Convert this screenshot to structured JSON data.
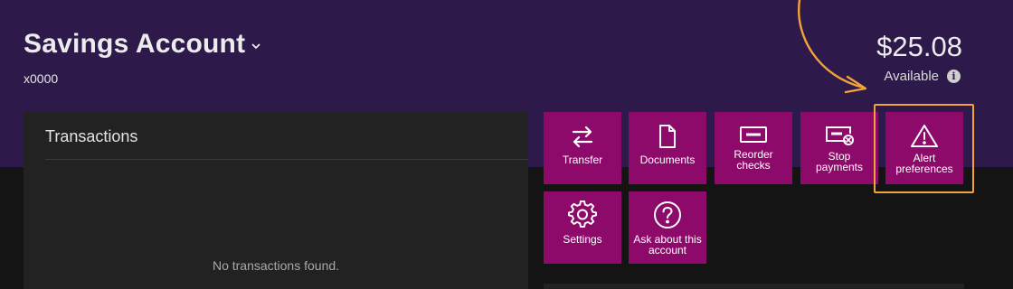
{
  "account": {
    "title": "Savings Account",
    "number": "x0000",
    "balance": "$25.08",
    "available_label": "Available"
  },
  "transactions": {
    "title": "Transactions",
    "empty_message": "No transactions found."
  },
  "actions": [
    {
      "label": "Transfer",
      "icon": "transfer-icon"
    },
    {
      "label": "Documents",
      "icon": "document-icon"
    },
    {
      "label": "Reorder checks",
      "icon": "check-icon"
    },
    {
      "label": "Stop payments",
      "icon": "stop-payment-icon"
    },
    {
      "label": "Alert preferences",
      "icon": "alert-icon"
    },
    {
      "label": "Settings",
      "icon": "gear-icon"
    },
    {
      "label": "Ask about this account",
      "icon": "help-icon"
    }
  ],
  "colors": {
    "header_bg": "#2d1a4a",
    "tile_bg": "#8e0a6a",
    "annotation": "#f2a33a",
    "page_bg": "#141414",
    "panel_bg": "#222222"
  }
}
